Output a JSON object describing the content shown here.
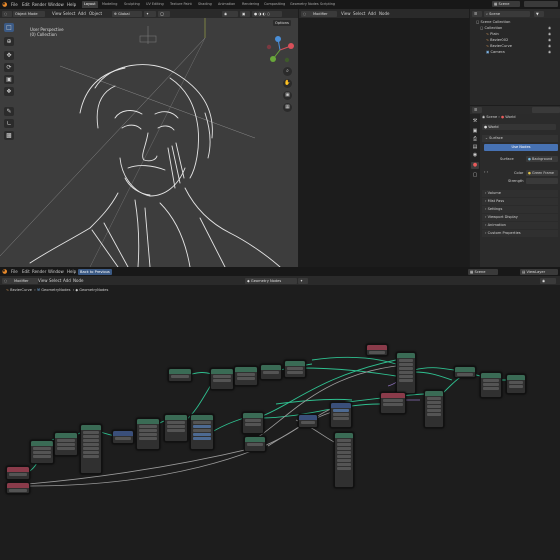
{
  "topbar": {
    "menus": [
      "File",
      "Edit",
      "Render",
      "Window",
      "Help"
    ],
    "workspaces": [
      "Layout",
      "Modeling",
      "Sculpting",
      "UV Editing",
      "Texture Paint",
      "Shading",
      "Animation",
      "Rendering",
      "Compositing",
      "Geometry Nodes",
      "Scripting"
    ],
    "active_workspace": "Layout",
    "scene_label": "Scene"
  },
  "viewport": {
    "header": {
      "mode": "Object Mode",
      "menus": [
        "View",
        "Select",
        "Add",
        "Object"
      ],
      "shading": "Global",
      "options": "Options"
    },
    "overlay_text": {
      "line1": "User Perspective",
      "line2": "(0) Collection"
    }
  },
  "right_header": {
    "mode": "Modifier",
    "menus": [
      "View",
      "Select",
      "Add",
      "Node"
    ]
  },
  "outliner": {
    "search": "Scene",
    "items": [
      {
        "label": "Scene Collection",
        "depth": 0,
        "color": "#cfcfcf"
      },
      {
        "label": "Collection",
        "depth": 1,
        "color": "#cfcfcf"
      },
      {
        "label": "Plain",
        "depth": 2,
        "color": "#d89a5a"
      },
      {
        "label": "Bezier002",
        "depth": 2,
        "color": "#d89a5a"
      },
      {
        "label": "BezierCurve",
        "depth": 2,
        "color": "#d89a5a"
      },
      {
        "label": "Camera",
        "depth": 2,
        "color": "#7fb6e8"
      }
    ]
  },
  "properties": {
    "breadcrumb_scene": "Scene",
    "breadcrumb_world": "World",
    "world_name": "World",
    "section_surface": "Surface",
    "use_nodes": "Use Nodes",
    "surface_label": "Surface",
    "surface_value": "Background",
    "color_label": "Color",
    "color_value": "Green Frame",
    "strength_label": "Strength",
    "sections": [
      "Volume",
      "Mist Pass",
      "Settings",
      "Viewport Display",
      "Animation",
      "Custom Properties"
    ]
  },
  "lower_topbar": {
    "menus": [
      "File",
      "Edit",
      "Render",
      "Window",
      "Help"
    ],
    "back_button": "Back to Previous",
    "scene_label": "Scene",
    "view_layer": "ViewLayer"
  },
  "node_editor": {
    "header": {
      "editor": "Modifier",
      "menus": [
        "View",
        "Select",
        "Add",
        "Node"
      ],
      "tree_name": "Geometry Nodes"
    },
    "breadcrumb": [
      "BezierCurve",
      "GeometryNodes",
      "GeometryNodes"
    ]
  },
  "colors": {
    "accent": "#4772b3",
    "socket_green": "#2fbf8f",
    "node_header_green": "#3a6b55",
    "node_header_red": "#8a3b4a",
    "node_header_blue": "#3a4f7a",
    "workspace_active": "#3b3b3b"
  }
}
